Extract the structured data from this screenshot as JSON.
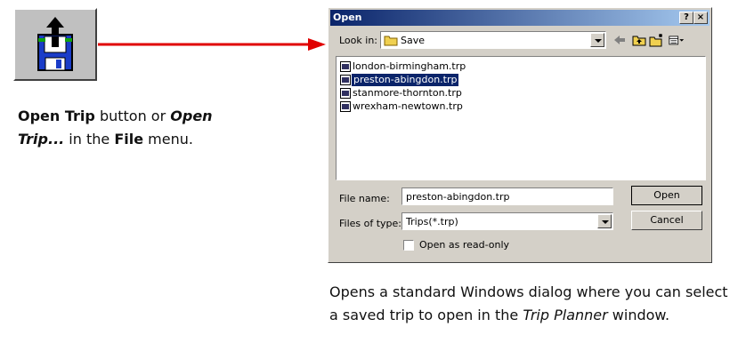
{
  "left_caption": {
    "bold1": "Open Trip",
    "text1": " button or ",
    "italic1": "Open Trip...",
    "text2": " in the ",
    "bold2": "File",
    "text3": " menu."
  },
  "dialog": {
    "title": "Open",
    "help_label": "?",
    "close_label": "×",
    "look_in_label": "Look in:",
    "look_in_value": "Save",
    "files": [
      {
        "name": "london-birmingham.trp",
        "selected": false
      },
      {
        "name": "preston-abingdon.trp",
        "selected": true
      },
      {
        "name": "stanmore-thornton.trp",
        "selected": false
      },
      {
        "name": "wrexham-newtown.trp",
        "selected": false
      }
    ],
    "file_name_label": "File name:",
    "file_name_value": "preston-abingdon.trp",
    "files_of_type_label": "Files of type:",
    "files_of_type_value": "Trips(*.trp)",
    "open_button": "Open",
    "cancel_button": "Cancel",
    "read_only_label": "Open as read-only"
  },
  "right_caption": {
    "text1": "Opens a standard Windows dialog where you can select a saved trip to open in the ",
    "italic1": "Trip Planner",
    "text2": " window."
  },
  "colors": {
    "arrow": "#e00000",
    "titlebar_start": "#0a246a",
    "titlebar_end": "#a6caf0",
    "selection": "#0a246a"
  }
}
